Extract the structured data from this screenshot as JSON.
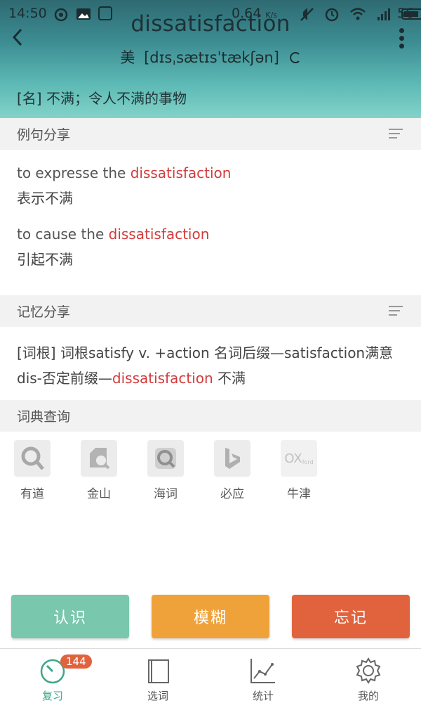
{
  "status_bar": {
    "time": "14:50",
    "speed": "0.64",
    "speed_unit": "K/s",
    "battery": "56"
  },
  "header": {
    "word": "dissatisfaction",
    "accent_label": "美",
    "phonetic": "[dɪsˌsætɪsˈtækʃən]"
  },
  "definition": "[名] 不满；令人不满的事物",
  "examples_section": {
    "title": "例句分享",
    "items": [
      {
        "en_before": "to expresse the ",
        "en_highlight": "dissatisfaction",
        "zh": "表示不满"
      },
      {
        "en_before": "to cause the ",
        "en_highlight": "dissatisfaction",
        "zh": "引起不满"
      }
    ]
  },
  "memory_section": {
    "title": "记忆分享",
    "text_before": "[词根] 词根satisfy v. +action 名词后缀—satisfaction满意 dis-否定前缀—",
    "highlight": "dissatisfaction",
    "text_after": " 不满"
  },
  "dict_section": {
    "title": "词典查询",
    "items": [
      {
        "label": "有道",
        "icon": "youdao-icon"
      },
      {
        "label": "金山",
        "icon": "jinshan-icon"
      },
      {
        "label": "海词",
        "icon": "haici-icon"
      },
      {
        "label": "必应",
        "icon": "bing-icon"
      },
      {
        "label": "牛津",
        "icon": "oxford-icon",
        "logo_text": "OX",
        "logo_sub": "ford"
      }
    ]
  },
  "actions": {
    "know": "认识",
    "fuzzy": "模糊",
    "forget": "忘记"
  },
  "tabs": [
    {
      "label": "复习",
      "badge": "144",
      "active": true
    },
    {
      "label": "选词"
    },
    {
      "label": "统计"
    },
    {
      "label": "我的"
    }
  ],
  "colors": {
    "highlight": "#d33b3b",
    "know": "#79c7ad",
    "fuzzy": "#f0a23a",
    "forget": "#e0633e",
    "active_tab": "#3fa68a"
  }
}
